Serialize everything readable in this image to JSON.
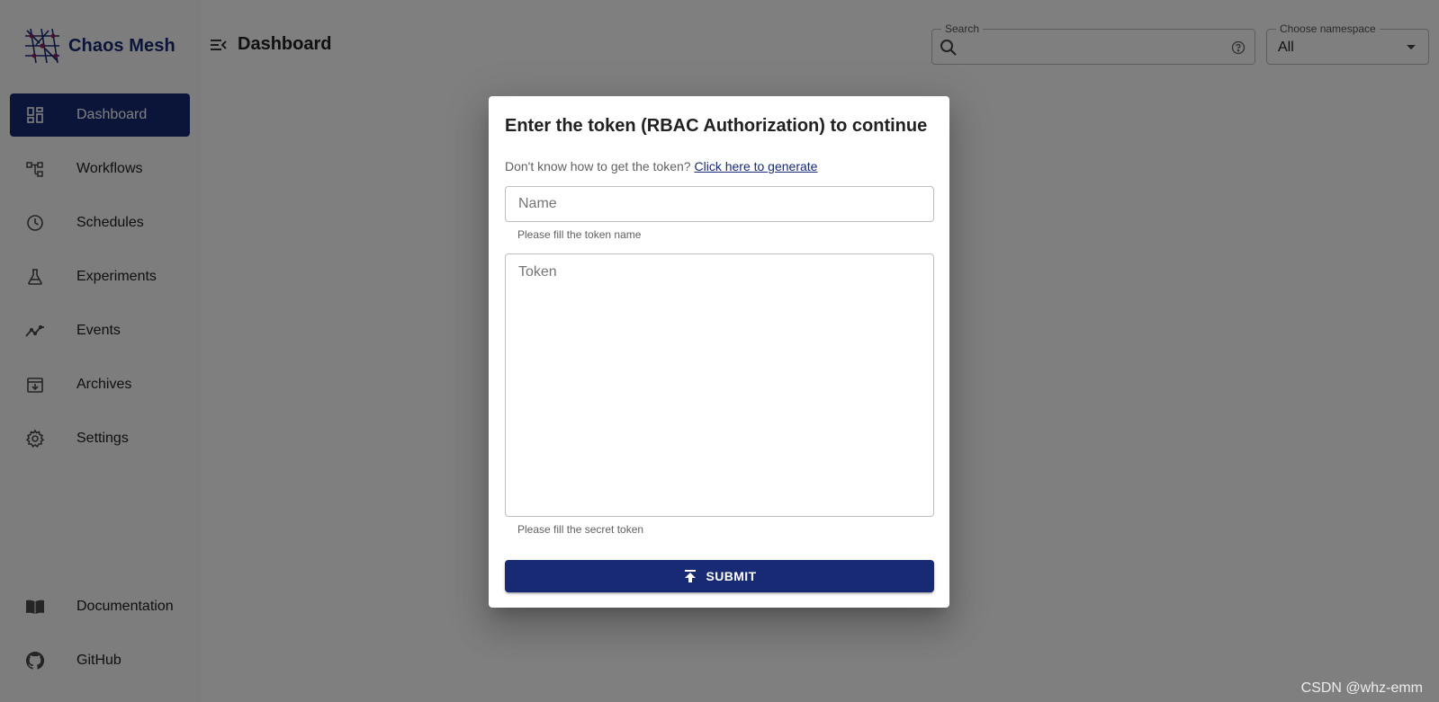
{
  "app": {
    "brand_name": "Chaos Mesh"
  },
  "sidebar": {
    "items": [
      {
        "label": "Dashboard",
        "icon": "dashboard-icon",
        "active": true
      },
      {
        "label": "Workflows",
        "icon": "workflow-icon"
      },
      {
        "label": "Schedules",
        "icon": "clock-icon"
      },
      {
        "label": "Experiments",
        "icon": "flask-icon"
      },
      {
        "label": "Events",
        "icon": "timeline-icon"
      },
      {
        "label": "Archives",
        "icon": "archive-icon"
      },
      {
        "label": "Settings",
        "icon": "gear-icon"
      }
    ],
    "bottom_items": [
      {
        "label": "Documentation",
        "icon": "book-icon"
      },
      {
        "label": "GitHub",
        "icon": "github-icon"
      }
    ]
  },
  "header": {
    "title": "Dashboard",
    "search": {
      "label": "Search",
      "value": ""
    },
    "namespace": {
      "label": "Choose namespace",
      "value": "All"
    }
  },
  "modal": {
    "title": "Enter the token (RBAC Authorization) to continue",
    "hint_text": "Don't know how to get the token?",
    "hint_link": "Click here to generate",
    "name_field": {
      "placeholder": "Name",
      "helper": "Please fill the token name"
    },
    "token_field": {
      "placeholder": "Token",
      "helper": "Please fill the secret token"
    },
    "submit_label": "SUBMIT"
  },
  "watermark": "CSDN @whz-emm",
  "colors": {
    "primary": "#172a73",
    "backdrop": "rgba(0,0,0,0.5)"
  }
}
